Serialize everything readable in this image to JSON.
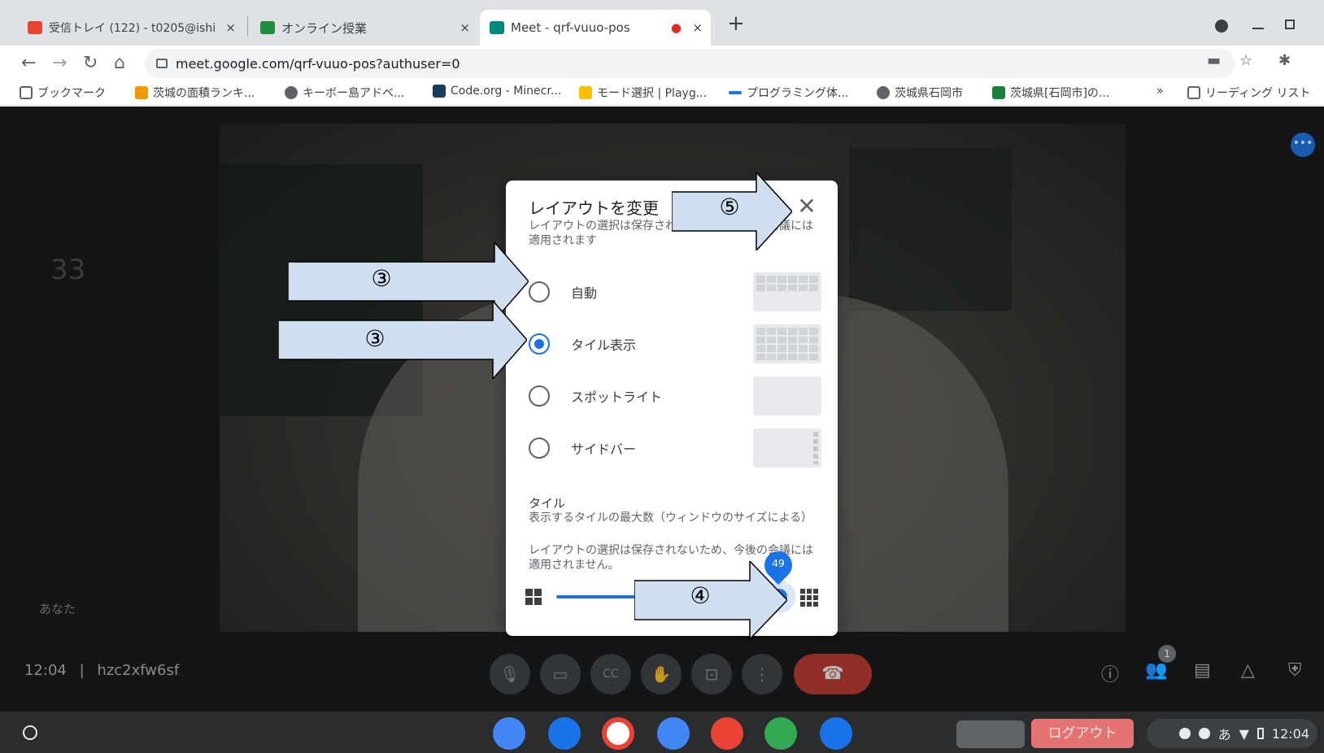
{
  "browser": {
    "tabs": [
      {
        "title": "受信トレイ (122) - t0205@ishi",
        "favicon_color": "#ea4335"
      },
      {
        "title": "オンライン授業",
        "favicon_color": "#1e8e3e"
      },
      {
        "title": "Meet - qrf-vuuo-pos",
        "favicon_color": "#00897b"
      }
    ],
    "close_glyph": "×",
    "new_tab_glyph": "+",
    "recording_glyph": "●",
    "url": "meet.google.com/qrf-vuuo-pos?authuser=0",
    "bookmarks": [
      "ブックマーク",
      "茨城の面積ランキ...",
      "キーボー島アドベ...",
      "Code.org - Minecr...",
      "モード選択 | Playg...",
      "プログラミング体...",
      "茨城県石岡市",
      "茨城県[石岡市]の...",
      "リーディング リスト"
    ],
    "more_bookmarks_glyph": "»"
  },
  "meet": {
    "tile_number": "33",
    "self_label": "あなた",
    "meeting_time": "12:04",
    "meeting_code": "hzc2xfw6sf",
    "participant_count": "1",
    "more_options_glyph": "•••"
  },
  "dialog": {
    "title": "レイアウトを変更",
    "subtitle": "レイアウトの選択は保存されないため、今後の会議には適用されます",
    "options": [
      {
        "label": "自動",
        "selected": false
      },
      {
        "label": "タイル表示",
        "selected": true
      },
      {
        "label": "スポットライト",
        "selected": false
      },
      {
        "label": "サイドバー",
        "selected": false
      }
    ],
    "tiles_title": "タイル",
    "tiles_desc": "表示するタイルの最大数（ウィンドウのサイズによる）",
    "tiles_note": "レイアウトの選択は保存されないため、今後の会議には適用されません。",
    "slider_value": "49",
    "slider_fraction": 0.98,
    "close_glyph": "✕"
  },
  "annotations": {
    "step3a": "③",
    "step3b": "③",
    "step4": "④",
    "step5": "⑤",
    "fill_color": "#cfdff0"
  },
  "shelf": {
    "logout_label": "ログアウト",
    "ime": "あ",
    "clock": "12:04",
    "apps": [
      "#4285f4",
      "#1a73e8",
      "#ffffff",
      "#4285f4",
      "#ea4335",
      "#34a853",
      "#1a73e8"
    ]
  }
}
